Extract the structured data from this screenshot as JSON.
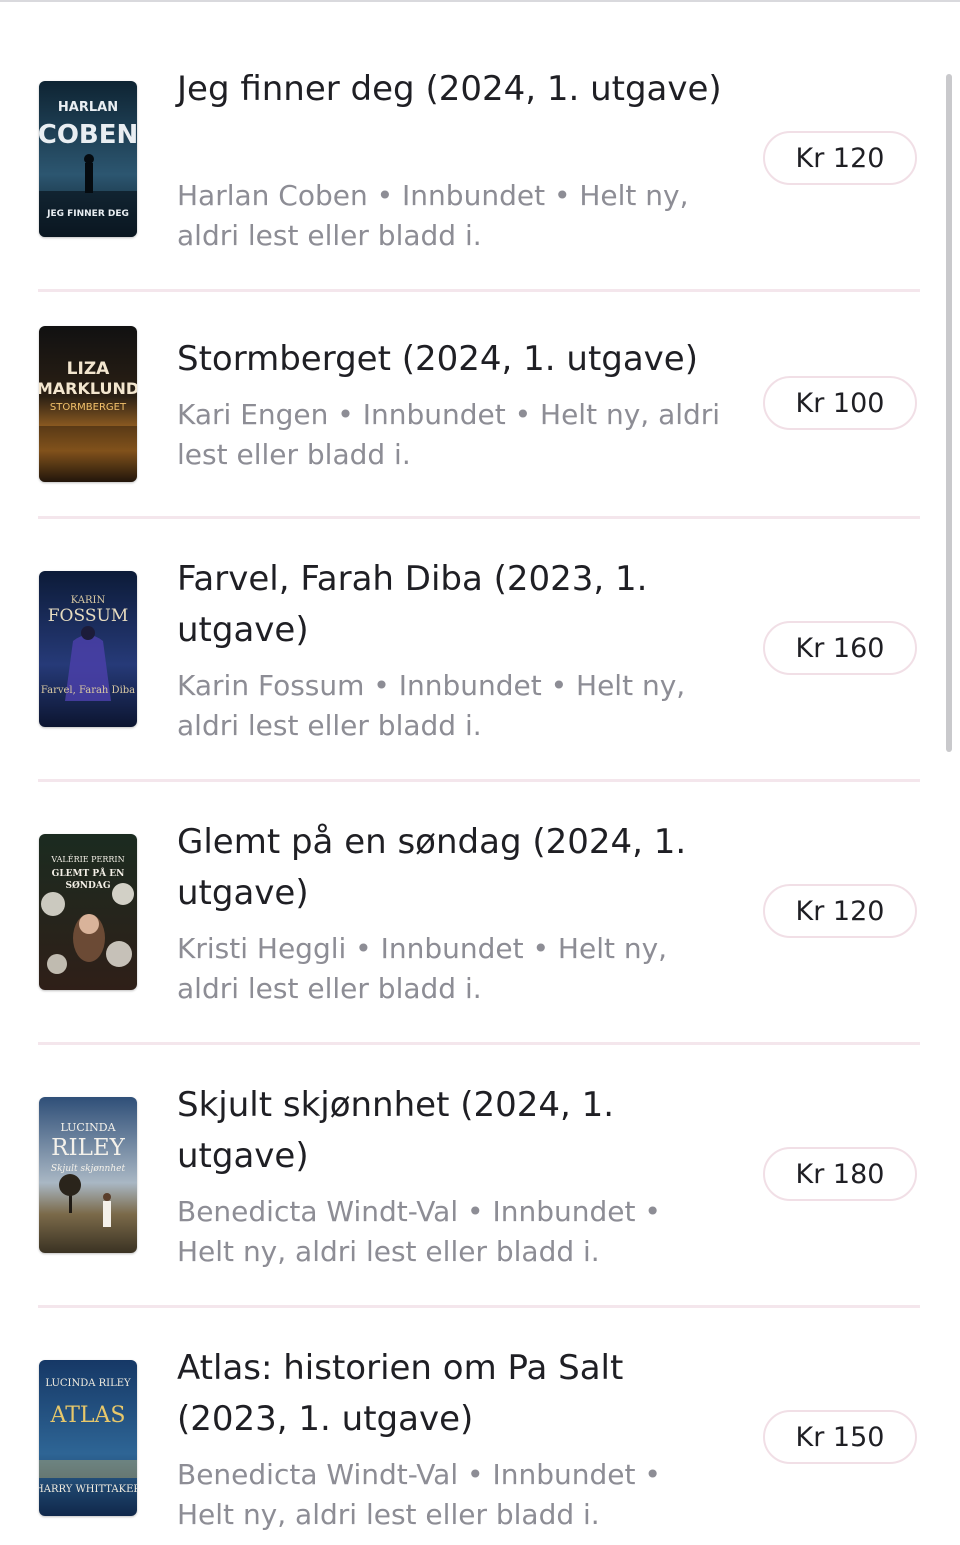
{
  "listings": [
    {
      "title": "Jeg finner deg (2024, 1. utgave)",
      "meta": "Harlan Coben • Innbundet • Helt ny, aldri lest eller bladd i.",
      "price": "Kr 120",
      "cover": {
        "line1": "HARLAN",
        "line2": "COBEN",
        "line3": "JEG FINNER DEG",
        "bg_top": "#0f2a3a",
        "bg_bottom": "#355b73",
        "accent": "#e9eef2"
      }
    },
    {
      "title": "Stormberget (2024, 1. utgave)",
      "meta": "Kari Engen • Innbundet • Helt ny, aldri lest eller bladd i.",
      "price": "Kr 100",
      "cover": {
        "line1": "LIZA",
        "line2": "MARKLUND",
        "line3": "STORMBERGET",
        "bg_top": "#161616",
        "bg_bottom": "#d98a2b",
        "accent": "#f2c16b"
      }
    },
    {
      "title": "Farvel, Farah Diba (2023, 1. utgave)",
      "meta": "Karin Fossum • Innbundet • Helt ny, aldri lest eller bladd i.",
      "price": "Kr 160",
      "cover": {
        "line1": "KARIN",
        "line2": "FOSSUM",
        "line3": "Farvel, Farah Diba",
        "bg_top": "#0e1f3f",
        "bg_bottom": "#3d3f8c",
        "accent": "#d9c9a2"
      }
    },
    {
      "title": "Glemt på en søndag (2024, 1. utgave)",
      "meta": "Kristi Heggli • Innbundet • Helt ny, aldri lest eller bladd i.",
      "price": "Kr 120",
      "cover": {
        "line1": "VALÉRIE PERRIN",
        "line2": "GLEMT PÅ EN",
        "line3": "SØNDAG",
        "bg_top": "#1a2a1e",
        "bg_bottom": "#3b2a22",
        "accent": "#f3efe6"
      }
    },
    {
      "title": "Skjult skjønnhet (2024, 1. utgave)",
      "meta": "Benedicta Windt-Val • Innbundet • Helt ny, aldri lest eller bladd i.",
      "price": "Kr 180",
      "cover": {
        "line1": "LUCINDA",
        "line2": "RILEY",
        "line3": "Skjult skjønnhet",
        "bg_top": "#3e5f87",
        "bg_bottom": "#7b6a4a",
        "accent": "#f4f1ea"
      }
    },
    {
      "title": "Atlas: historien om Pa Salt (2023, 1. utgave)",
      "meta": "Benedicta Windt-Val • Innbundet • Helt ny, aldri lest eller bladd i.",
      "price": "Kr 150",
      "cover": {
        "line1": "LUCINDA RILEY",
        "line2": "ATLAS",
        "line3": "HARRY WHITTAKER",
        "bg_top": "#173a66",
        "bg_bottom": "#2b5f8f",
        "accent": "#e8c86a"
      }
    }
  ]
}
